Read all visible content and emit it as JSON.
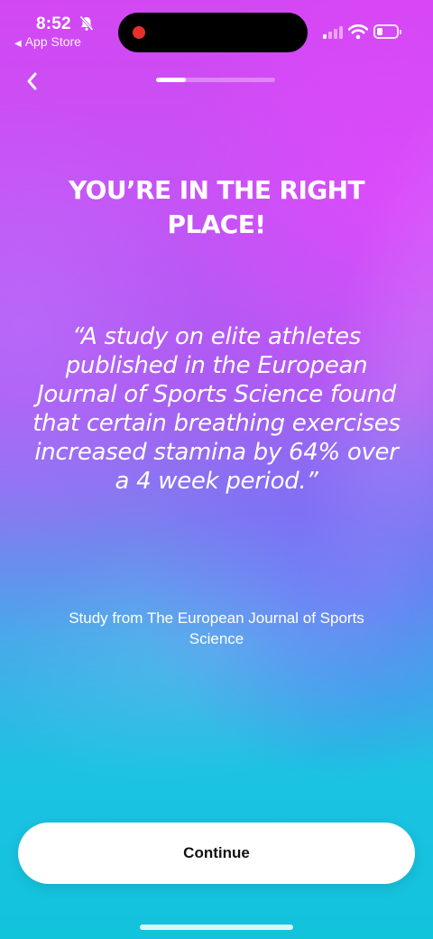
{
  "status_bar": {
    "time": "8:52",
    "back_app_label": "App Store",
    "icons": [
      "bell-slash-icon",
      "cellular-signal-icon",
      "wifi-icon",
      "battery-icon"
    ],
    "battery_level": 0.3
  },
  "nav": {
    "back_icon": "chevron-left-icon",
    "progress": 0.25
  },
  "content": {
    "headline": "YOU’RE IN THE RIGHT PLACE!",
    "quote": "“A study on elite athletes published in the European Journal of Sports Science found that certain breathing exercises increased stamina by 64% over a 4 week period.”",
    "source": "Study from The European Journal of Sports Science"
  },
  "actions": {
    "continue_label": "Continue"
  },
  "colors": {
    "background_top": "#d347f3",
    "background_bottom": "#12c3dc",
    "button_bg": "#ffffff",
    "button_text": "#111111",
    "recording_dot": "#e5312b"
  }
}
